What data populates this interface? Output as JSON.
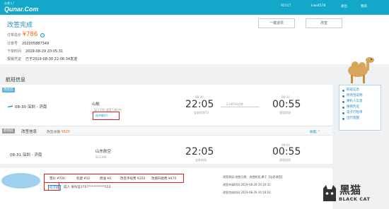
{
  "header": {
    "slogan": "去哪儿?",
    "brand": "Qunar.Com",
    "nav": [
      "95117",
      "kiwi4578",
      "退出",
      "我的"
    ]
  },
  "order": {
    "title": "改签完成",
    "total_label": "订单总价",
    "total_value": "¥786",
    "order_no_label": "订单号",
    "order_no_value": "202005887349",
    "booking_time_label": "下单时间",
    "booking_time_value": "2019-08-29 20:05:31",
    "reimburse_label": "报销凭证",
    "reimburse_value": "已于2019-08-30 22:06:34发送"
  },
  "buttons": {
    "refund": "一键退票",
    "change": "改签"
  },
  "flight_section": {
    "title": "航班信息",
    "tag": "改签后",
    "date_route": "08-30  深圳 - 济南",
    "airline": "山航",
    "flight_no": "SC1190  波音738(中)",
    "cabin": "经济舱(Y)",
    "dep_date": "08-30",
    "dep_time": "22:05",
    "dep_airport": "宝安机场T3",
    "duration": "2小时50分钟",
    "arr_date": "08-31",
    "arr_time": "00:55",
    "arr_airport": "遥墙机场"
  },
  "change_info": {
    "tag": "原航班",
    "title": "改签信息",
    "fee_label": "改签总额",
    "fee_value": "¥820",
    "collapse": "收起"
  },
  "original_flight": {
    "date_route": "08-31  深圳 - 济南",
    "airline": "山东航空",
    "flight_no": "SC1190",
    "dep_time": "22:05",
    "dep_airport": "宝安机场",
    "arr_date": "09-01",
    "arr_time": "00:55",
    "arr_airport": "遥墙机场"
  },
  "fare": {
    "items": [
      "票价 ¥700",
      "机建 ¥50",
      "燃油 ¥0",
      "改签手续费 ¥350",
      "改期升舱费 ¥470"
    ],
    "cabin_tag": "经济舱",
    "passenger": "成人  身份证3707**********553"
  },
  "notes": {
    "line1": "改签原因:选错日期、选错航班,属于【自愿改签】",
    "line2": "改签申请时间:2019-08-29 20:10:32",
    "line3": "改签完成时间:2019-08-29 20:18:02"
  },
  "side_nav": [
    "航班信息",
    "原改签说明",
    "乘机人信息",
    "报销凭证",
    "电子行程单",
    "出行提醒"
  ],
  "watermark": {
    "cn": "黑猫",
    "en": "BLACK CAT"
  }
}
